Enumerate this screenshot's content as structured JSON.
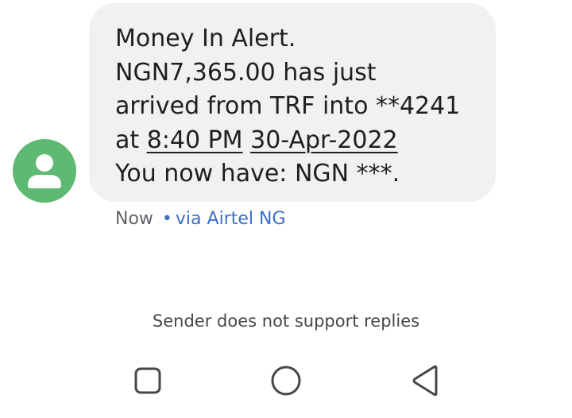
{
  "message": {
    "lines": [
      {
        "text": "Money In Alert."
      },
      {
        "text": "NGN7,365.00 has just"
      },
      {
        "text": "arrived from TRF into **4241"
      },
      {
        "prefix": "at ",
        "time_link": "8:40 PM",
        "sep": " ",
        "date_link": "30-Apr-2022"
      },
      {
        "text": "You now have: NGN ***."
      }
    ]
  },
  "meta": {
    "time": "Now",
    "separator": "•",
    "via": "via Airtel NG"
  },
  "notice": "Sender does not support replies",
  "colors": {
    "avatar_bg": "#5eba72",
    "bubble_bg": "#f1f1f1",
    "link_blue": "#3b6fc8"
  },
  "icons": {
    "avatar": "person-icon",
    "nav": [
      "recents-square-icon",
      "home-circle-icon",
      "back-triangle-icon"
    ]
  }
}
